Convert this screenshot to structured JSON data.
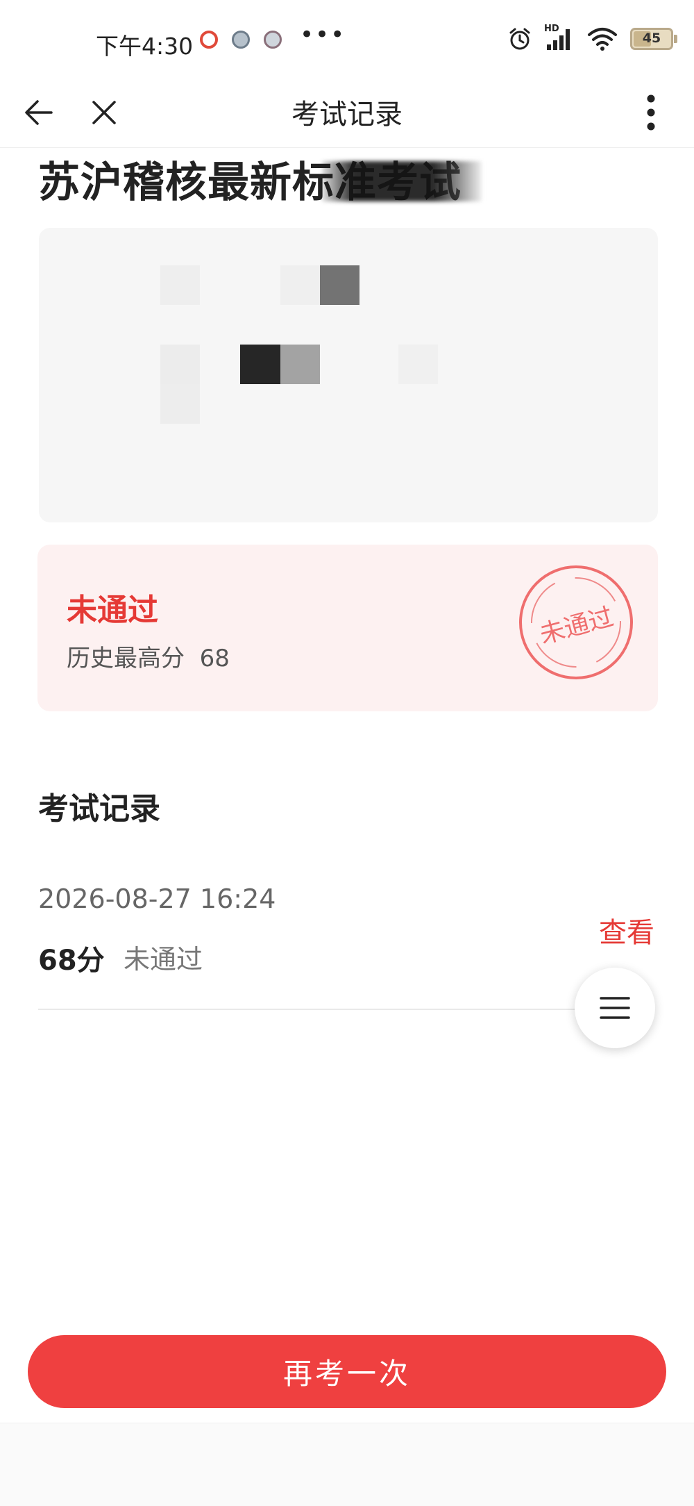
{
  "status_bar": {
    "time": "下午4:30",
    "more": "•••",
    "signal_label": "HD",
    "battery_level": "45"
  },
  "nav": {
    "title": "考试记录"
  },
  "exam": {
    "title": "苏沪稽核最新标准考试"
  },
  "result": {
    "status": "未通过",
    "best_label": "历史最高分",
    "best_score": "68",
    "stamp_text": "未通过"
  },
  "records": {
    "heading": "考试记录",
    "items": [
      {
        "date": "2026-08-27 16:24",
        "score": "68分",
        "status": "未通过",
        "action": "查看"
      }
    ]
  },
  "actions": {
    "retake_label": "再考一次"
  },
  "colors": {
    "accent": "#ef4040",
    "fail_text": "#e53935",
    "result_bg": "#fdf1f1"
  }
}
